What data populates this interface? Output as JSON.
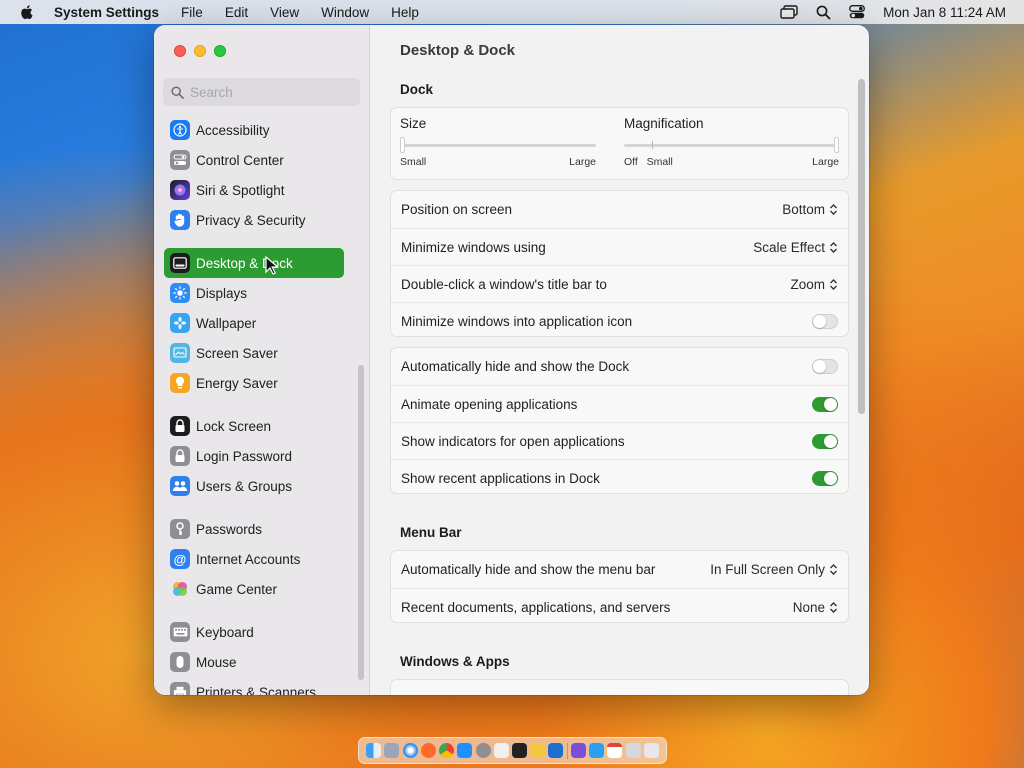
{
  "menubar": {
    "app_name": "System Settings",
    "items": [
      "File",
      "Edit",
      "View",
      "Window",
      "Help"
    ],
    "clock": "Mon Jan 8  11:24 AM"
  },
  "sidebar": {
    "search_placeholder": "Search",
    "items": [
      {
        "label": "Accessibility",
        "icon": "accessibility-icon",
        "color": "#1a7cf5"
      },
      {
        "label": "Control Center",
        "icon": "control-center-icon",
        "color": "#8e8e93"
      },
      {
        "label": "Siri & Spotlight",
        "icon": "siri-icon",
        "color": "#6a3be0"
      },
      {
        "label": "Privacy & Security",
        "icon": "hand-icon",
        "color": "#2f7ff0"
      },
      {
        "label": "Desktop & Dock",
        "icon": "dock-icon",
        "color": "#1c1c1e",
        "active": true
      },
      {
        "label": "Displays",
        "icon": "sun-icon",
        "color": "#2c8ef5"
      },
      {
        "label": "Wallpaper",
        "icon": "flower-icon",
        "color": "#38a5f0"
      },
      {
        "label": "Screen Saver",
        "icon": "screen-saver-icon",
        "color": "#4fb6e8"
      },
      {
        "label": "Energy Saver",
        "icon": "bulb-icon",
        "color": "#f5a623"
      },
      {
        "label": "Lock Screen",
        "icon": "lock-icon",
        "color": "#1c1c1e"
      },
      {
        "label": "Login Password",
        "icon": "login-lock-icon",
        "color": "#8e8e93"
      },
      {
        "label": "Users & Groups",
        "icon": "users-icon",
        "color": "#2f7ff0"
      },
      {
        "label": "Passwords",
        "icon": "key-icon",
        "color": "#8e8e93"
      },
      {
        "label": "Internet Accounts",
        "icon": "at-icon",
        "color": "#2f7ff0"
      },
      {
        "label": "Game Center",
        "icon": "game-center-icon",
        "color": "#e0509a"
      },
      {
        "label": "Keyboard",
        "icon": "keyboard-icon",
        "color": "#8e8e93"
      },
      {
        "label": "Mouse",
        "icon": "mouse-icon",
        "color": "#8e8e93"
      },
      {
        "label": "Printers & Scanners",
        "icon": "printer-icon",
        "color": "#8e8e93"
      }
    ]
  },
  "main": {
    "title": "Desktop & Dock",
    "dock_section": "Dock",
    "size": {
      "label": "Size",
      "min": "Small",
      "max": "Large",
      "value": 0.0
    },
    "magnification": {
      "label": "Magnification",
      "off": "Off",
      "min": "Small",
      "max": "Large",
      "value": 1.0
    },
    "popups": [
      {
        "label": "Position on screen",
        "value": "Bottom"
      },
      {
        "label": "Minimize windows using",
        "value": "Scale Effect"
      },
      {
        "label": "Double-click a window's title bar to",
        "value": "Zoom"
      }
    ],
    "minimize_into_icon": {
      "label": "Minimize windows into application icon",
      "on": false
    },
    "toggles": [
      {
        "label": "Automatically hide and show the Dock",
        "on": false
      },
      {
        "label": "Animate opening applications",
        "on": true
      },
      {
        "label": "Show indicators for open applications",
        "on": true
      },
      {
        "label": "Show recent applications in Dock",
        "on": true
      }
    ],
    "menu_bar_section": "Menu Bar",
    "menu_bar_rows": [
      {
        "label": "Automatically hide and show the menu bar",
        "value": "In Full Screen Only"
      },
      {
        "label": "Recent documents, applications, and servers",
        "value": "None"
      }
    ],
    "windows_apps_section": "Windows & Apps"
  },
  "colors": {
    "accent": "#2c9b31"
  }
}
